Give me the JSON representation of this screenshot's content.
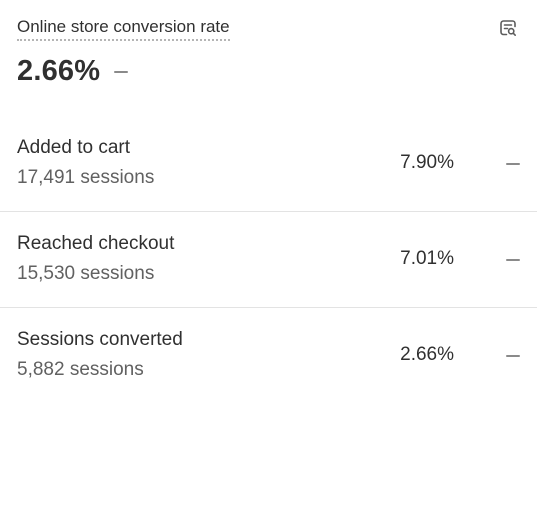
{
  "card": {
    "title": "Online store conversion rate",
    "report_icon": "report-search-icon",
    "metric_value": "2.66%",
    "metric_trend_icon": "dash-icon"
  },
  "rows": [
    {
      "label": "Added to cart",
      "sessions": "17,491 sessions",
      "percent": "7.90%",
      "trend_icon": "dash-icon"
    },
    {
      "label": "Reached checkout",
      "sessions": "15,530 sessions",
      "percent": "7.01%",
      "trend_icon": "dash-icon"
    },
    {
      "label": "Sessions converted",
      "sessions": "5,882 sessions",
      "percent": "2.66%",
      "trend_icon": "dash-icon"
    }
  ],
  "colors": {
    "text_primary": "#303030",
    "text_secondary": "#616161",
    "divider": "#e3e3e3",
    "dash": "#8a8a8a"
  }
}
